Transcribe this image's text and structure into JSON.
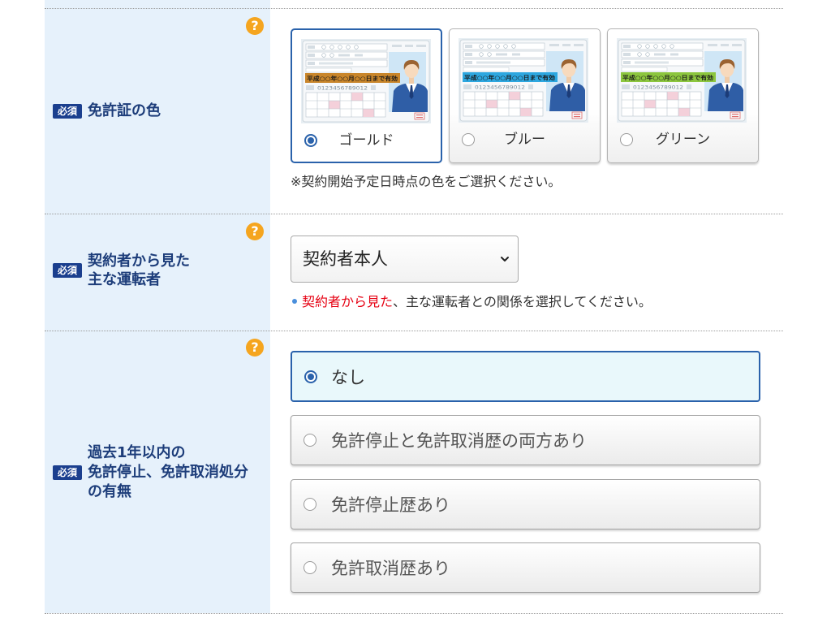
{
  "colors": {
    "label_column_bg": "#e6f1fb",
    "label_text": "#1d3d7a",
    "required_badge_bg": "#1b3f8e",
    "help_icon_bg": "#f5a51f",
    "selected_border": "#2a62ab",
    "selected_option_bg": "#e9f8fb",
    "highlight_red": "#e60012",
    "bullet_blue": "#4a8fdc"
  },
  "icons": {
    "help": "question-circle-icon",
    "dropdown": "chevron-down-icon",
    "bullet": "bullet-icon"
  },
  "form": {
    "license_color": {
      "required_badge": "必須",
      "label": "免許証の色",
      "help_glyph": "?",
      "options": [
        {
          "label": "ゴールド",
          "selected": true,
          "band_color": "#c9862b"
        },
        {
          "label": "ブルー",
          "selected": false,
          "band_color": "#2da7e0"
        },
        {
          "label": "グリーン",
          "selected": false,
          "band_color": "#8cc63e"
        }
      ],
      "illustration": {
        "validity_text": "平成○○年○○月○○日まで有効",
        "license_number": "0123456789012"
      },
      "note": "※契約開始予定日時点の色をご選択ください。"
    },
    "main_driver": {
      "required_badge": "必須",
      "label_lines": [
        "契約者から見た",
        "主な運転者"
      ],
      "help_glyph": "?",
      "select_value": "契約者本人",
      "note_highlight": "契約者から見た",
      "note_rest": "、主な運転者との関係を選択してください。"
    },
    "suspension_history": {
      "required_badge": "必須",
      "label_lines": [
        "過去1年以内の",
        "免許停止、免許取消処分",
        "の有無"
      ],
      "help_glyph": "?",
      "options": [
        {
          "label": "なし",
          "selected": true
        },
        {
          "label": "免許停止と免許取消歴の両方あり",
          "selected": false
        },
        {
          "label": "免許停止歴あり",
          "selected": false
        },
        {
          "label": "免許取消歴あり",
          "selected": false
        }
      ]
    }
  }
}
